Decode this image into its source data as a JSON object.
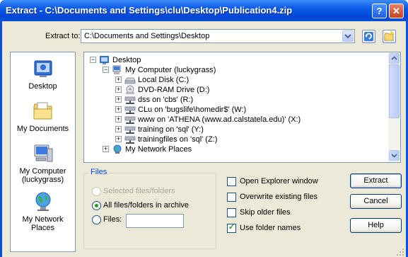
{
  "window": {
    "title": "Extract - C:\\Documents and Settings\\clu\\Desktop\\Publication4.zip",
    "help_button": "?",
    "close_button": "✕"
  },
  "extract_to": {
    "label": "Extract to:",
    "value": "C:\\Documents and Settings\\Desktop"
  },
  "places": [
    {
      "label": "Desktop",
      "icon": "desktop-icon"
    },
    {
      "label": "My Documents",
      "icon": "folder-icon"
    },
    {
      "label": "My Computer (luckygrass)",
      "icon": "computer-icon"
    },
    {
      "label": "My Network Places",
      "icon": "network-icon"
    }
  ],
  "tree": [
    {
      "label": "Desktop",
      "icon": "desktop-icon",
      "expander": "−"
    },
    {
      "label": "My Computer (luckygrass)",
      "icon": "computer-icon",
      "expander": "−"
    },
    {
      "label": "Local Disk (C:)",
      "icon": "drive-icon",
      "expander": "+"
    },
    {
      "label": "DVD-RAM Drive (D:)",
      "icon": "cd-drive-icon",
      "expander": "+"
    },
    {
      "label": "dss on 'cbs' (R:)",
      "icon": "network-drive-icon",
      "expander": "+"
    },
    {
      "label": "CLu on 'bugslife\\homedir$' (W:)",
      "icon": "network-drive-icon",
      "expander": "+"
    },
    {
      "label": "www on 'ATHENA (www.ad.calstatela.edu)' (X:)",
      "icon": "network-drive-icon",
      "expander": "+"
    },
    {
      "label": "training on 'sql' (Y:)",
      "icon": "network-drive-icon",
      "expander": "+"
    },
    {
      "label": "trainingfiles on 'sql' (Z:)",
      "icon": "network-drive-icon",
      "expander": "+"
    },
    {
      "label": "My Network Places",
      "icon": "network-icon",
      "expander": "+"
    }
  ],
  "files_group": {
    "title": "Files",
    "selected_label": "Selected files/folders",
    "all_label": "All files/folders in archive",
    "files_label": "Files:",
    "files_value": ""
  },
  "options": [
    {
      "label": "Open Explorer window",
      "checked": false
    },
    {
      "label": "Overwrite existing files",
      "checked": false
    },
    {
      "label": "Skip older files",
      "checked": false
    },
    {
      "label": "Use folder names",
      "checked": true
    }
  ],
  "buttons": {
    "extract": "Extract",
    "cancel": "Cancel",
    "help": "Help"
  },
  "colors": {
    "title_bar": "#0a5ae8",
    "dialog_face": "#ece9d8",
    "group_title": "#0046d5",
    "check_mark": "#21a121"
  }
}
